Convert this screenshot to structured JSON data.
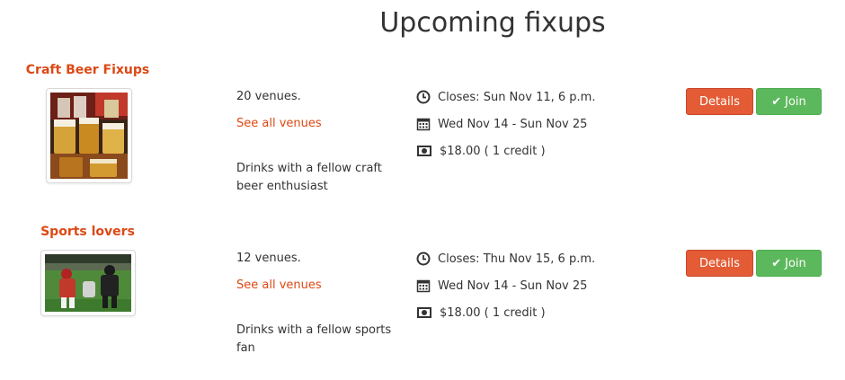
{
  "page": {
    "title": "Upcoming fixups"
  },
  "fixups": [
    {
      "name": "Craft Beer Fixups",
      "venues": "20 venues.",
      "see_all": "See all venues",
      "description": "Drinks with a fellow craft beer enthusiast",
      "closes": "Closes: Sun Nov 11, 6 p.m.",
      "dates": "Wed Nov 14 - Sun Nov 25",
      "price": "$18.00 ( 1 credit )",
      "details_label": "Details",
      "join_label": "Join",
      "image_icon": "beer-glasses-photo"
    },
    {
      "name": "Sports lovers",
      "venues": "12 venues.",
      "see_all": "See all venues",
      "description": "Drinks with a fellow sports fan",
      "closes": "Closes: Thu Nov 15, 6 p.m.",
      "dates": "Wed Nov 14 - Sun Nov 25",
      "price": "$18.00 ( 1 credit )",
      "details_label": "Details",
      "join_label": "Join",
      "image_icon": "football-game-photo"
    }
  ],
  "colors": {
    "accent": "#dd4814",
    "details_button": "#e45c35",
    "join_button": "#5cb85c"
  },
  "icons": {
    "closes": "clock-icon",
    "dates": "calendar-icon",
    "price": "money-icon",
    "join": "check-icon"
  }
}
